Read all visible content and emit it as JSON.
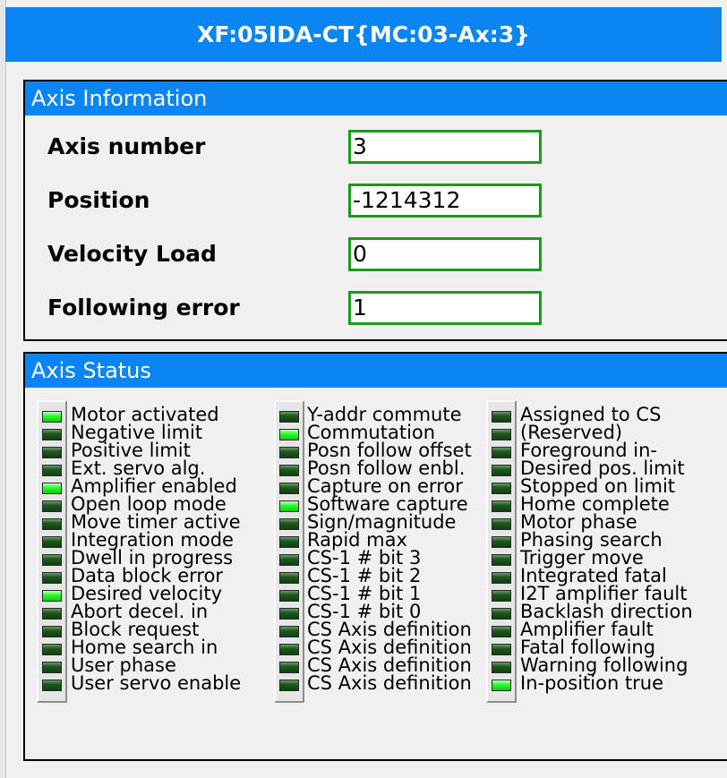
{
  "title": "XF:05IDA-CT{MC:03-Ax:3}",
  "axis_info": {
    "header": "Axis Information",
    "fields": [
      {
        "label": "Axis number",
        "value": "3"
      },
      {
        "label": "Position",
        "value": "-1214312"
      },
      {
        "label": "Velocity Load",
        "value": "0"
      },
      {
        "label": "Following error",
        "value": "1"
      }
    ]
  },
  "axis_status": {
    "header": "Axis Status",
    "colors": {
      "led_on": "#2cff2c",
      "led_off": "#1f5a1f"
    },
    "columns": [
      [
        {
          "label": "Motor activated",
          "on": true
        },
        {
          "label": "Negative limit",
          "on": false
        },
        {
          "label": "Positive limit",
          "on": false
        },
        {
          "label": "Ext. servo alg.",
          "on": false
        },
        {
          "label": "Amplifier enabled",
          "on": true
        },
        {
          "label": "Open loop mode",
          "on": false
        },
        {
          "label": "Move timer active",
          "on": false
        },
        {
          "label": "Integration mode",
          "on": false
        },
        {
          "label": "Dwell in progress",
          "on": false
        },
        {
          "label": "Data block error",
          "on": false
        },
        {
          "label": "Desired velocity",
          "on": true
        },
        {
          "label": "Abort decel.  in",
          "on": false
        },
        {
          "label": "Block request",
          "on": false
        },
        {
          "label": "Home search in",
          "on": false
        },
        {
          "label": "User phase",
          "on": false
        },
        {
          "label": "User servo enable",
          "on": false
        }
      ],
      [
        {
          "label": "Y-addr commute",
          "on": false
        },
        {
          "label": "Commutation",
          "on": true
        },
        {
          "label": "Posn follow offset",
          "on": false
        },
        {
          "label": "Posn follow enbl.",
          "on": false
        },
        {
          "label": "Capture on error",
          "on": false
        },
        {
          "label": "Software capture",
          "on": true
        },
        {
          "label": "Sign/magnitude",
          "on": false
        },
        {
          "label": "Rapid max",
          "on": false
        },
        {
          "label": "CS-1 # bit 3",
          "on": false
        },
        {
          "label": "CS-1 # bit 2",
          "on": false
        },
        {
          "label": "CS-1 # bit 1",
          "on": false
        },
        {
          "label": "CS-1 # bit 0",
          "on": false
        },
        {
          "label": "CS Axis definition",
          "on": false
        },
        {
          "label": "CS Axis definition",
          "on": false
        },
        {
          "label": "CS Axis definition",
          "on": false
        },
        {
          "label": "CS Axis definition",
          "on": false
        }
      ],
      [
        {
          "label": "Assigned to CS",
          "on": false
        },
        {
          "label": "(Reserved)",
          "on": false
        },
        {
          "label": "Foreground in-",
          "on": false
        },
        {
          "label": "Desired pos. limit",
          "on": false
        },
        {
          "label": "Stopped on limit",
          "on": false
        },
        {
          "label": "Home complete",
          "on": false
        },
        {
          "label": "Motor phase",
          "on": false
        },
        {
          "label": "Phasing search",
          "on": false
        },
        {
          "label": "Trigger move",
          "on": false
        },
        {
          "label": "Integrated fatal",
          "on": false
        },
        {
          "label": "I2T amplifier fault",
          "on": false
        },
        {
          "label": "Backlash direction",
          "on": false
        },
        {
          "label": "Amplifier fault",
          "on": false
        },
        {
          "label": "Fatal following",
          "on": false
        },
        {
          "label": "Warning following",
          "on": false
        },
        {
          "label": "In-position true",
          "on": true
        }
      ]
    ]
  }
}
